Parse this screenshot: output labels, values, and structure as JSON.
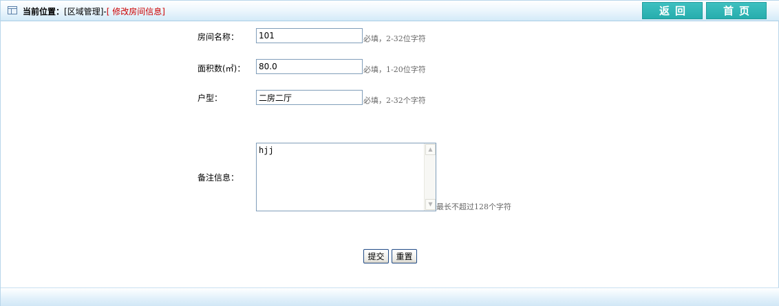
{
  "header": {
    "position_label": "当前位置：",
    "crumb_section": "[区域管理]",
    "crumb_sep": "-",
    "crumb_current": "[ 修改房间信息]",
    "back_label": "返回",
    "home_label": "首页"
  },
  "form": {
    "room_name": {
      "label": "房间名称：",
      "value": "101",
      "hint": "必填，2-32位字符"
    },
    "area": {
      "label": "面积数(㎡)：",
      "value": "80.0",
      "hint": "必填，1-20位字符"
    },
    "layout": {
      "label": "户型：",
      "value": "二房二厅",
      "hint": "必填，2-32个字符"
    },
    "remarks": {
      "label": "备注信息：",
      "value": "hjj",
      "hint": "最长不超过128个字符"
    },
    "submit_label": "提交",
    "reset_label": "重置"
  },
  "colors": {
    "accent": "#27adad",
    "current_crumb": "#cc0000",
    "header_border": "#a9cde6"
  },
  "icons": {
    "position": "table-icon",
    "scroll_up": "arrow-up-icon",
    "scroll_down": "arrow-down-icon"
  }
}
